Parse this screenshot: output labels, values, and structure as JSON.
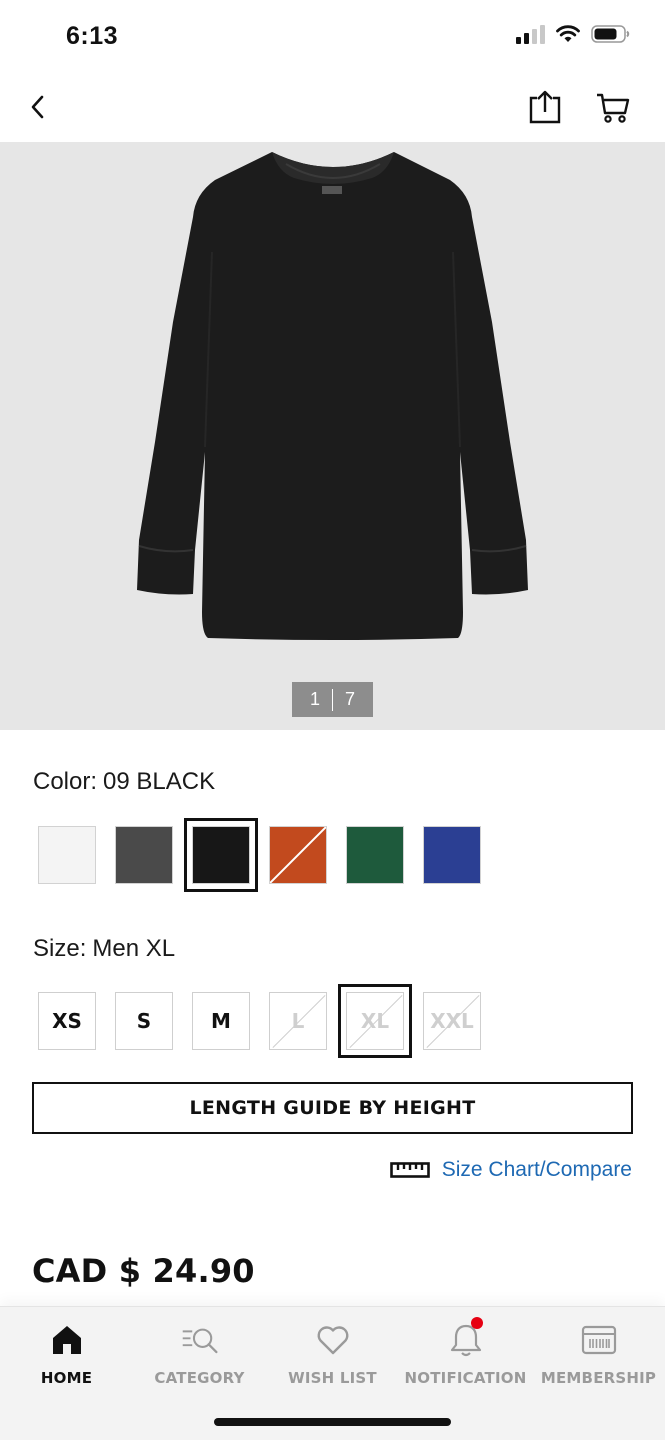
{
  "status_bar": {
    "time": "6:13",
    "icons": [
      "signal-icon",
      "wifi-icon",
      "battery-icon"
    ]
  },
  "nav": {
    "back_icon": "chevron-left-icon",
    "share_icon": "share-icon",
    "cart_icon": "cart-icon"
  },
  "image": {
    "current": "1",
    "total": "7"
  },
  "color": {
    "label": "Color:",
    "value": "09 BLACK",
    "swatches": [
      {
        "name": "white",
        "hex": "#f4f4f4",
        "selected": false,
        "unavailable": false
      },
      {
        "name": "dark-gray",
        "hex": "#4a4a4a",
        "selected": false,
        "unavailable": false
      },
      {
        "name": "black",
        "hex": "#171717",
        "selected": true,
        "unavailable": false
      },
      {
        "name": "orange",
        "hex": "#c24a1e",
        "selected": false,
        "unavailable": true
      },
      {
        "name": "green",
        "hex": "#1e5a3c",
        "selected": false,
        "unavailable": false
      },
      {
        "name": "blue",
        "hex": "#2b3f93",
        "selected": false,
        "unavailable": false
      }
    ]
  },
  "size": {
    "label": "Size:",
    "value": "Men XL",
    "options": [
      {
        "label": "XS",
        "disabled": false,
        "selected": false
      },
      {
        "label": "S",
        "disabled": false,
        "selected": false
      },
      {
        "label": "M",
        "disabled": false,
        "selected": false
      },
      {
        "label": "L",
        "disabled": true,
        "selected": false
      },
      {
        "label": "XL",
        "disabled": true,
        "selected": true
      },
      {
        "label": "XXL",
        "disabled": true,
        "selected": false
      }
    ]
  },
  "length_guide_label": "LENGTH GUIDE BY HEIGHT",
  "size_chart_label": "Size Chart/Compare",
  "price": "CAD $ 24.90",
  "tabs": [
    {
      "label": "HOME",
      "icon": "home-icon",
      "active": true
    },
    {
      "label": "CATEGORY",
      "icon": "category-search-icon",
      "active": false
    },
    {
      "label": "WISH LIST",
      "icon": "heart-icon",
      "active": false
    },
    {
      "label": "NOTIFICATION",
      "icon": "bell-icon",
      "active": false,
      "badge": true
    },
    {
      "label": "MEMBERSHIP",
      "icon": "membership-card-icon",
      "active": false
    }
  ],
  "colors": {
    "link": "#1e69b3",
    "notification_badge": "#e60012",
    "image_bg": "#e6e6e6"
  }
}
